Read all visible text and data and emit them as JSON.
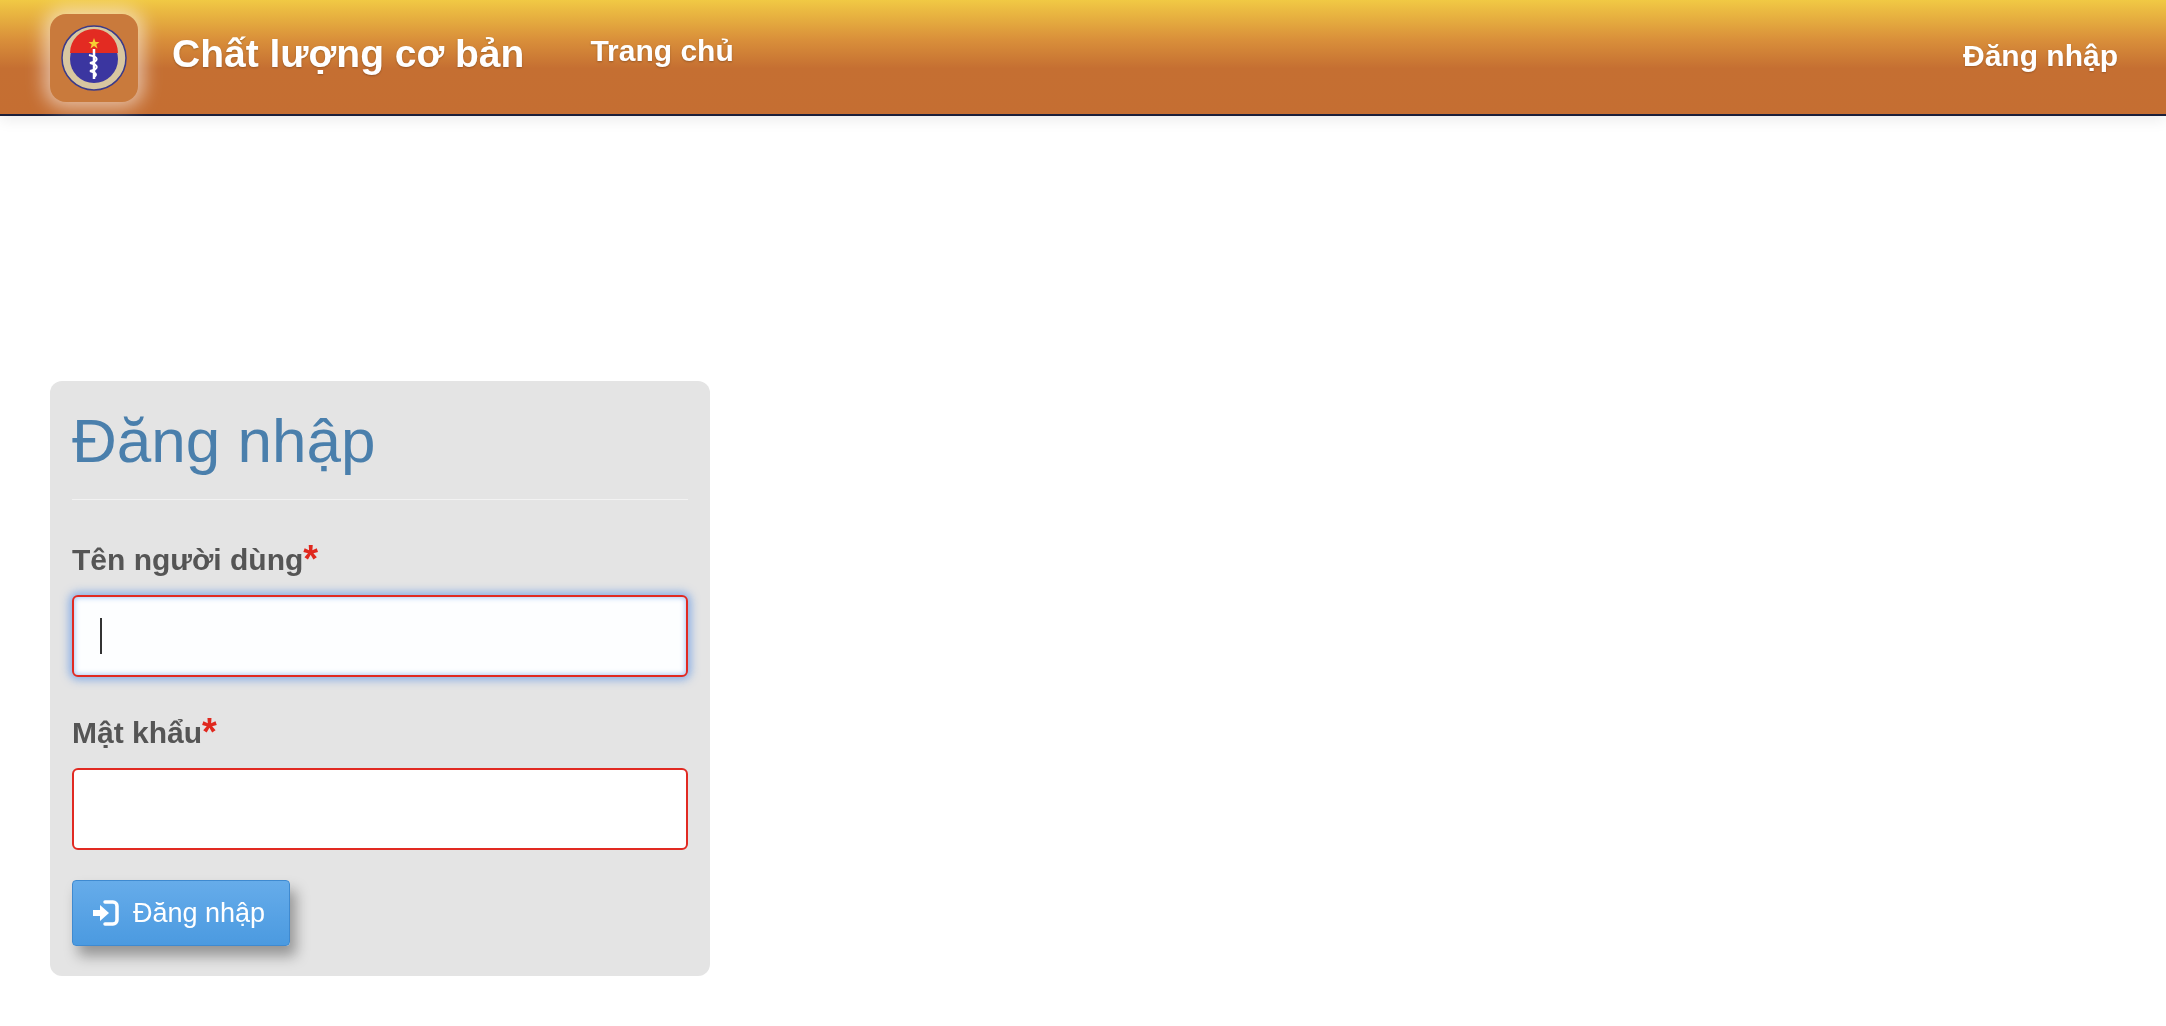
{
  "header": {
    "site_title": "Chất lượng cơ bản",
    "nav": [
      {
        "label": "Trang chủ"
      }
    ],
    "login_link": "Đăng nhập"
  },
  "login_form": {
    "title": "Đăng nhập",
    "fields": [
      {
        "label": "Tên người dùng",
        "required_mark": "*",
        "focused": true
      },
      {
        "label": "Mật khẩu",
        "required_mark": "*",
        "focused": false
      }
    ],
    "submit": "Đăng nhập"
  }
}
